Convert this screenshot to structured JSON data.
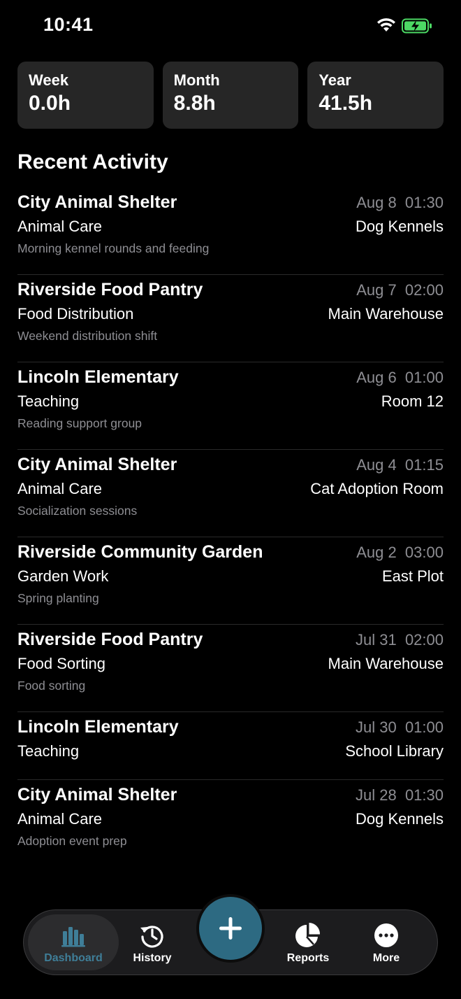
{
  "status_bar": {
    "time": "10:41"
  },
  "stats": [
    {
      "label": "Week",
      "value": "0.0h"
    },
    {
      "label": "Month",
      "value": "8.8h"
    },
    {
      "label": "Year",
      "value": "41.5h"
    }
  ],
  "recent_activity": {
    "title": "Recent Activity",
    "items": [
      {
        "org": "City Animal Shelter",
        "date": "Aug 8  01:30",
        "category": "Animal Care",
        "location": "Dog Kennels",
        "notes": "Morning kennel rounds and feeding"
      },
      {
        "org": "Riverside Food Pantry",
        "date": "Aug 7  02:00",
        "category": "Food Distribution",
        "location": "Main Warehouse",
        "notes": "Weekend distribution shift"
      },
      {
        "org": "Lincoln Elementary",
        "date": "Aug 6  01:00",
        "category": "Teaching",
        "location": "Room 12",
        "notes": "Reading support group"
      },
      {
        "org": "City Animal Shelter",
        "date": "Aug 4  01:15",
        "category": "Animal Care",
        "location": "Cat Adoption Room",
        "notes": "Socialization sessions"
      },
      {
        "org": "Riverside Community Garden",
        "date": "Aug 2  03:00",
        "category": "Garden Work",
        "location": "East Plot",
        "notes": "Spring planting"
      },
      {
        "org": "Riverside Food Pantry",
        "date": "Jul 31  02:00",
        "category": "Food Sorting",
        "location": "Main Warehouse",
        "notes": "Food sorting"
      },
      {
        "org": "Lincoln Elementary",
        "date": "Jul 30  01:00",
        "category": "Teaching",
        "location": "School Library",
        "notes": ""
      },
      {
        "org": "City Animal Shelter",
        "date": "Jul 28  01:30",
        "category": "Animal Care",
        "location": "Dog Kennels",
        "notes": "Adoption event prep"
      }
    ]
  },
  "tab_bar": {
    "dashboard_label": "Dashboard",
    "history_label": "History",
    "reports_label": "Reports",
    "more_label": "More"
  },
  "colors": {
    "background": "#000000",
    "card": "#262626",
    "secondary_text": "#8e8e93",
    "accent": "#3f7e98",
    "fab": "#2d6a82",
    "battery": "#4cd964"
  }
}
